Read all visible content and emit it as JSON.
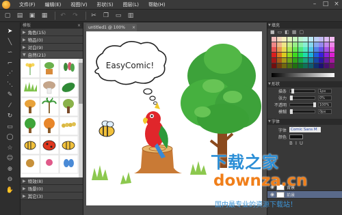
{
  "menubar": {
    "items": [
      "文件(F)",
      "编辑(E)",
      "视图(V)",
      "形状(S)",
      "图层(L)",
      "帮助(H)"
    ],
    "window_controls": [
      "–",
      "□",
      "×"
    ]
  },
  "toolbar": {
    "icons": [
      "new-icon",
      "open-icon",
      "save-icon",
      "save-as-icon",
      "undo-icon",
      "redo-icon",
      "cut-icon",
      "copy-icon",
      "paste-icon",
      "delete-icon"
    ]
  },
  "tools": [
    "select",
    "line",
    "curve",
    "polyline",
    "bezier",
    "pen",
    "brush",
    "rotate",
    "rectangle",
    "ellipse",
    "star",
    "face",
    "zoom-in",
    "zoom-out",
    "hand"
  ],
  "library": {
    "header": "模板",
    "categories_top": [
      {
        "label": "角色(15)",
        "open": false
      },
      {
        "label": "物品(0)",
        "open": false
      },
      {
        "label": "对白(9)",
        "open": false
      },
      {
        "label": "自然(21)",
        "open": true
      }
    ],
    "categories_bottom": [
      {
        "label": "特效(8)",
        "open": false
      },
      {
        "label": "场景(0)",
        "open": false
      },
      {
        "label": "其它(3)",
        "open": false
      }
    ]
  },
  "canvas": {
    "tab_label": "untitled1 @ 100%",
    "speech_text": "EasyComic!"
  },
  "rightpanel": {
    "fill_header": "填充",
    "shape_header": "形状",
    "shape_props": [
      {
        "label": "描条",
        "value": "1px"
      },
      {
        "label": "张力",
        "value": "0%"
      },
      {
        "label": "不透明",
        "value": "100%"
      },
      {
        "label": "模糊",
        "value": "0px"
      }
    ],
    "font_header": "字体",
    "font_label": "字体",
    "font_value": "Comic Sans M",
    "color_label": "颜色",
    "layers": [
      {
        "label": "背景",
        "selected": false
      },
      {
        "label": "前景",
        "selected": true
      }
    ]
  },
  "watermark": {
    "line1": "下载之家",
    "line2": "downza.cn",
    "line3": "国内最专业的资源下载站！"
  },
  "colors": {
    "accent": "#2a8ed6",
    "watermark_orange": "#f07f1a",
    "selected_layer": "#5a6a8a"
  }
}
